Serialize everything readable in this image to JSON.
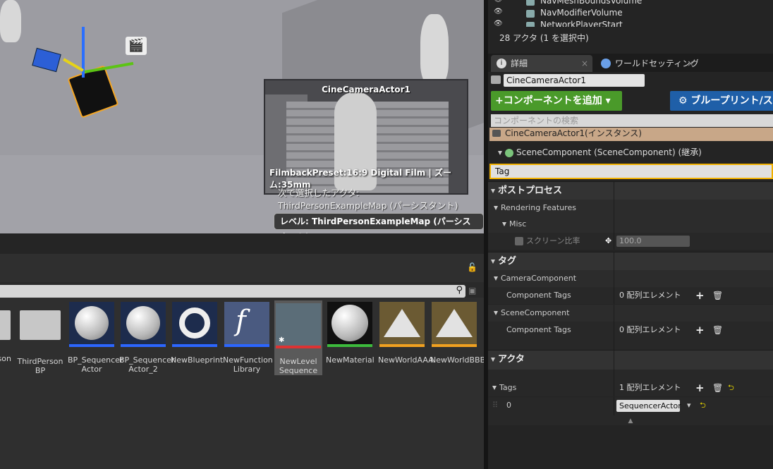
{
  "viewport": {
    "preview_title": "CineCameraActor1",
    "filmback": "FilmbackPreset:16:9 Digital Film | ズーム:35mm",
    "selected_line1": "次で選択したアクタ:",
    "selected_line2": "ThirdPersonExampleMap (パーシスタント)",
    "level_badge": "レベル: ThirdPersonExampleMap (パーシスタント)"
  },
  "content_browser": {
    "assets": [
      {
        "label": "son"
      },
      {
        "label": "ThirdPerson BP"
      },
      {
        "label": "BP_Sequencer Actor"
      },
      {
        "label": "BP_Sequencer Actor_2"
      },
      {
        "label": "NewBlueprint"
      },
      {
        "label": "NewFunction Library"
      },
      {
        "label": "NewLevel Sequence"
      },
      {
        "label": "NewMaterial"
      },
      {
        "label": "NewWorldAAA"
      },
      {
        "label": "NewWorldBBB"
      }
    ]
  },
  "outliner": {
    "rows": [
      "NavMeshBoundsVolume",
      "NavModifierVolume",
      "NetworkPlayerStart"
    ],
    "actor_count": "28 アクタ (1 を選択中)"
  },
  "details": {
    "tab_details": "詳細",
    "tab_world": "ワールドセッティング",
    "actor_name": "CineCameraActor1",
    "add_component": "+コンポーネントを追加",
    "blueprint_button": "ブループリント/ス",
    "component_search_placeholder": "コンポーネントの検索",
    "instance_row": "CineCameraActor1(インスタンス)",
    "scene_component": "SceneComponent (SceneComponent) (継承)",
    "search_value": "Tag",
    "cat_postprocess": "ポストプロセス",
    "rendering_features": "Rendering Features",
    "misc": "Misc",
    "screen_percentage": "スクリーン比率",
    "screen_percentage_value": "100.0",
    "cat_tag": "タグ",
    "camera_component": "CameraComponent",
    "component_tags": "Component Tags",
    "array_zero": "0 配列エレメント",
    "scene_component_short": "SceneComponent",
    "component_tags_2": "Component Tags",
    "array_zero_2": "0 配列エレメント",
    "cat_actor": "アクタ",
    "tags_label": "Tags",
    "array_one": "1 配列エレメント",
    "index_0": "0",
    "tag_value": "SequencerActor"
  }
}
